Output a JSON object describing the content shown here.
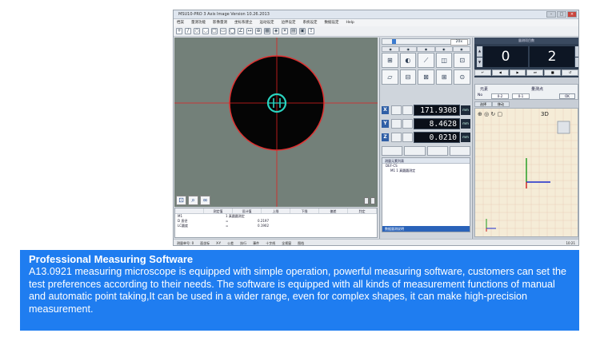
{
  "window": {
    "title": "MSU10-PRO 3 Axis Image  Version 10.26.2013",
    "menu": [
      "档案",
      "量测功能",
      "影像量测",
      "坐标系建立",
      "运动设定",
      "边界设定",
      "系统设定",
      "数据设定",
      "Help"
    ]
  },
  "camera": {
    "zoom_label": "20x",
    "overlay_color": "#e02020",
    "edge_color": "#e03030",
    "target_color": "#2ad4c0"
  },
  "results": {
    "headers": [
      "",
      "测定值",
      "设计值",
      "上限",
      "下限",
      "偏差",
      "判定"
    ],
    "rows": [
      {
        "name": "M1",
        "label": "1 真圆圆测定",
        "value": ""
      },
      {
        "name": "D 直径",
        "label": "=",
        "value": "0.2197"
      },
      {
        "name": "LC圆度",
        "label": "=",
        "value": "0.1902"
      }
    ]
  },
  "status": [
    "测量单号: 0",
    "面坐标",
    "X-Y",
    "公差",
    "执行",
    "事件",
    "十字线",
    "全视窗",
    "图档"
  ],
  "clock": "10:21",
  "coordinates": [
    {
      "axis": "X",
      "value": "171.9308",
      "unit": "mm"
    },
    {
      "axis": "Y",
      "value": "8.4628",
      "unit": "mm"
    },
    {
      "axis": "Z",
      "value": "0.0210",
      "unit": "mm"
    }
  ],
  "tree": {
    "header": "测量元素列表",
    "root": "DEF-CS",
    "child": "M1  1 真圆圆测定",
    "footer": "数据量测说明"
  },
  "counter": {
    "label": "量测项目数",
    "left": "0",
    "right": "2"
  },
  "options": {
    "o1": "元素",
    "o2": "量测点",
    "no_label": "No",
    "box1": "0-2",
    "box2": "0-1",
    "ok": "OK"
  },
  "view_tabs": [
    "选择",
    "移动"
  ],
  "view3d": {
    "tools": "⊕ ◎ ↻ ▢",
    "label": "3D",
    "x_color": "#cc1a1a",
    "y_color": "#1a9a1a",
    "z_color": "#1a2acc"
  },
  "caption": {
    "title": "Professional Measuring Software",
    "body": "A13.0921 measuring microscope is equipped with simple operation, powerful measuring software, customers can set the test preferences according to their needs. The software is equipped with all kinds of measurement functions of manual and automatic point taking,It can be used in a wider range, even for complex shapes, it can make high-precision measurement."
  }
}
